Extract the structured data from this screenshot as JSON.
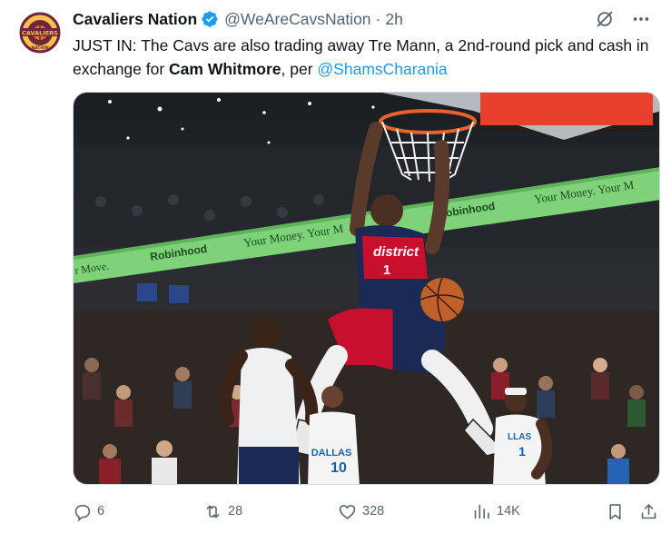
{
  "author": {
    "display_name": "Cavaliers Nation",
    "handle": "@WeAreCavsNation",
    "time": "2h",
    "avatar_text_top": "CAVALIERS",
    "avatar_text_bottom": "NATION"
  },
  "tweet": {
    "text_lead": "JUST IN: The Cavs are also trading away Tre Mann, a 2nd-round pick and cash in exchange for ",
    "text_bold": "Cam Whitmore",
    "text_mid": ", per ",
    "mention": "@ShamsCharania"
  },
  "media": {
    "banner_left": "r Move.",
    "banner_brand": "Robinhood",
    "banner_mid": "Your Money. Your M",
    "banner_brand2": "Robinhood",
    "banner_right": "Your Money. Your M",
    "jersey_wordmark": "district",
    "jersey_number": "1",
    "dallas_text": "DALLAS",
    "dallas_number": "10",
    "dallas_number_right": "1",
    "dallas_text_right": "LLAS"
  },
  "actions": {
    "replies": "6",
    "reposts": "28",
    "likes": "328",
    "views": "14K"
  },
  "colors": {
    "link": "#1d9bf0",
    "muted": "#536471",
    "verified": "#1d9bf0",
    "banner_green": "#7fd27a",
    "wizards_red": "#c8102e",
    "wizards_navy": "#0c2340"
  },
  "icons": [
    "verified-badge-icon",
    "grok-icon",
    "more-icon",
    "reply-icon",
    "repost-icon",
    "like-icon",
    "views-icon",
    "bookmark-icon",
    "share-icon"
  ]
}
